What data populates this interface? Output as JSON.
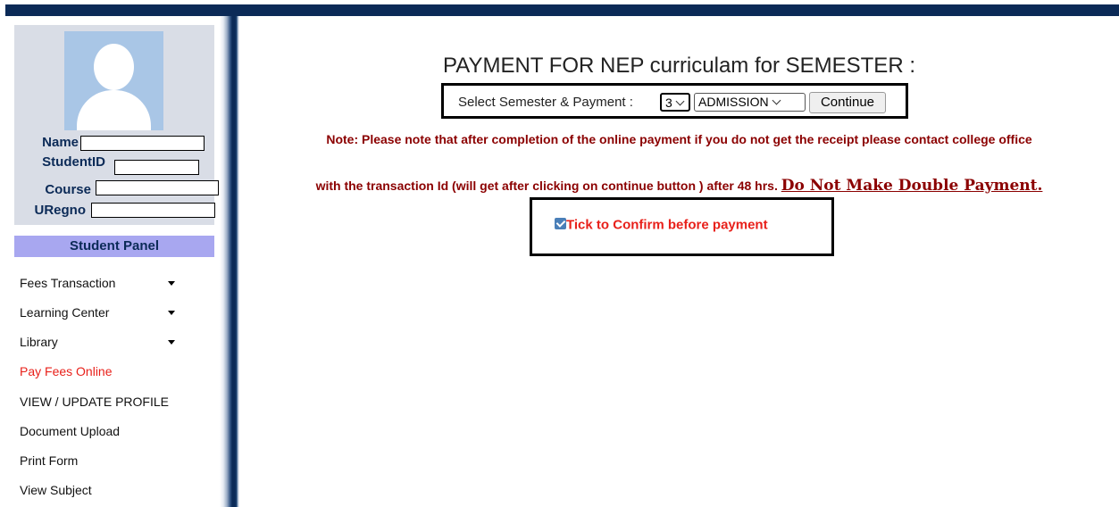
{
  "profile": {
    "name_label": "Name",
    "studentid_label": "StudentID",
    "course_label": "Course",
    "uregno_label": "URegno",
    "name_value": "",
    "studentid_value": "",
    "course_value": "",
    "uregno_value": ""
  },
  "sidebar": {
    "panel_title": "Student Panel",
    "items": [
      {
        "label": "Fees Transaction",
        "has_caret": true
      },
      {
        "label": "Learning Center",
        "has_caret": true
      },
      {
        "label": "Library",
        "has_caret": true
      },
      {
        "label": "Pay Fees Online",
        "active": true
      },
      {
        "label": "VIEW / UPDATE PROFILE"
      },
      {
        "label": "Document Upload"
      },
      {
        "label": "Print Form"
      },
      {
        "label": "View Subject"
      }
    ]
  },
  "main": {
    "title": "PAYMENT FOR NEP curriculam for SEMESTER :",
    "select_label": "Select Semester & Payment :",
    "semester_value": "3",
    "payment_value": "ADMISSION",
    "continue_label": "Continue",
    "note_line1": "Note: Please note that after completion of the online payment if you do not get the receipt please contact college office",
    "note_line2": "with the transaction Id (will get after clicking on continue button ) after 48 hrs.",
    "warning": "Do Not Make Double Payment.",
    "confirm_label": "Tick to Confirm before payment",
    "confirm_checked": true
  },
  "colors": {
    "header_bar": "#0b2a57",
    "panel_title_bg": "#a8a7f0",
    "note_text": "#8b0000",
    "active_link": "#e8201a"
  }
}
